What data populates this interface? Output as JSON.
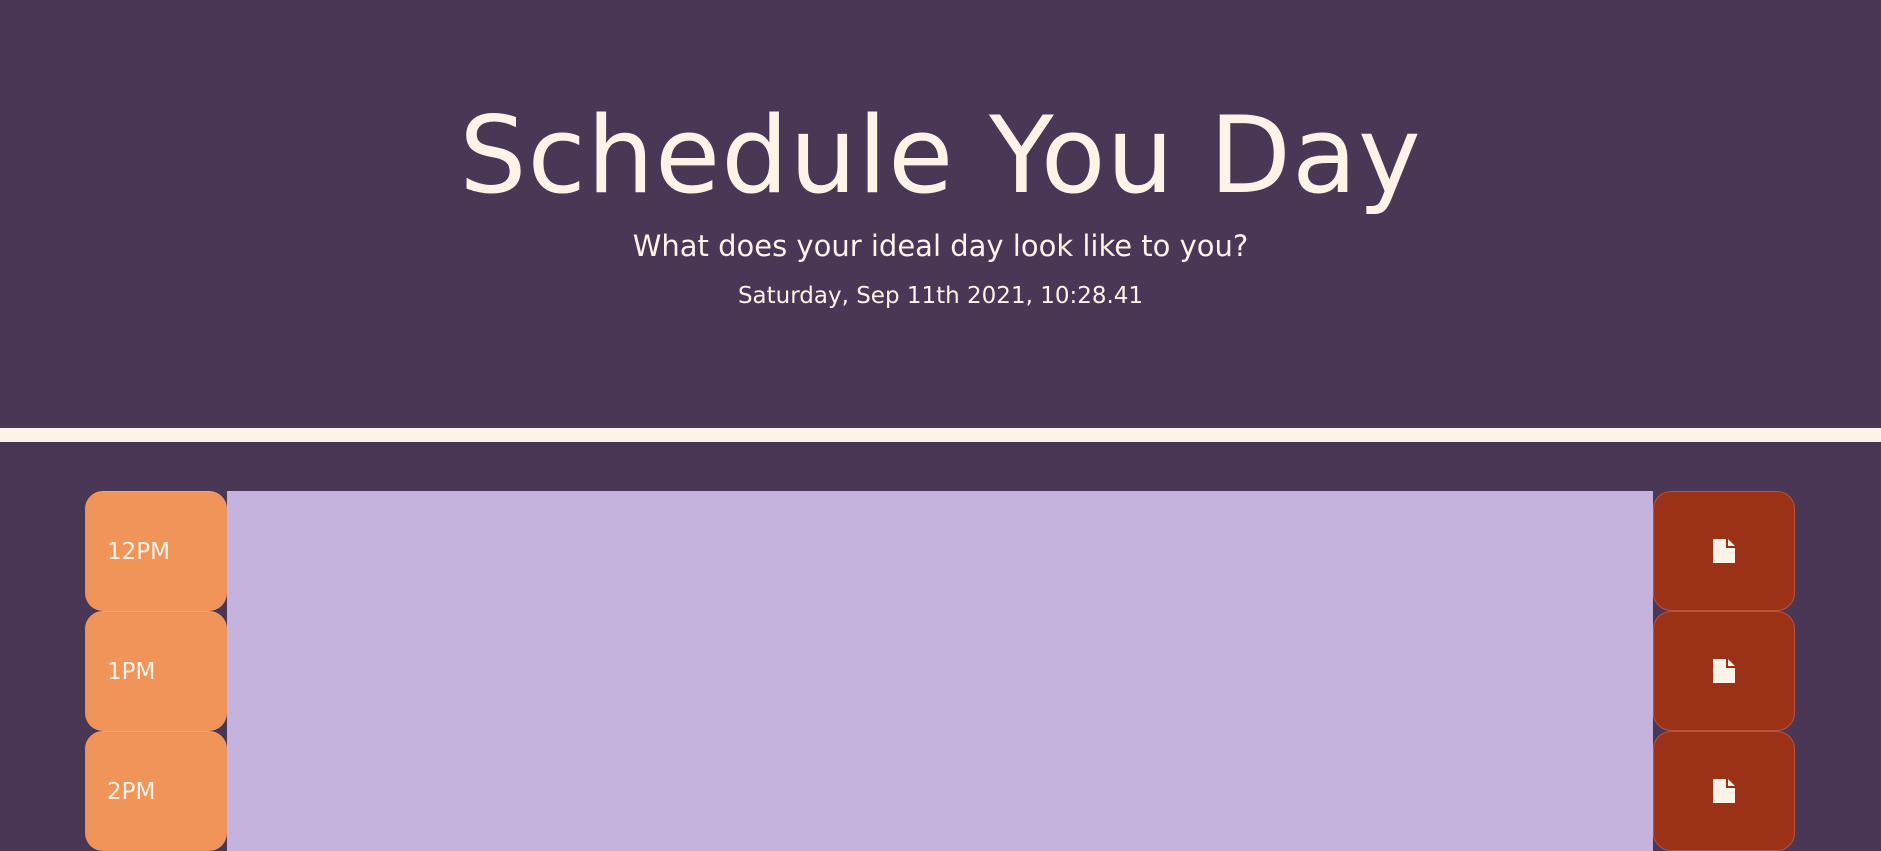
{
  "header": {
    "title": "Schedule You Day",
    "lead": "What does your ideal day look like to you?",
    "current_day": "Saturday, Sep 11th 2021, 10:28.41"
  },
  "colors": {
    "background": "#4a3655",
    "cream": "#fdf3e7",
    "hour": "#f09459",
    "future": "#c5b3dd",
    "save": "#9b3218"
  },
  "schedule": {
    "rows": [
      {
        "hour": "12PM",
        "text": "",
        "save_icon": "file-icon"
      },
      {
        "hour": "1PM",
        "text": "",
        "save_icon": "file-icon"
      },
      {
        "hour": "2PM",
        "text": "",
        "save_icon": "file-icon"
      }
    ]
  }
}
